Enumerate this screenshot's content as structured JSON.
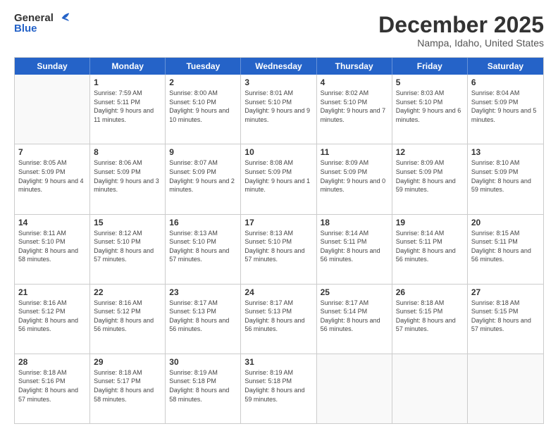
{
  "header": {
    "logo_general": "General",
    "logo_blue": "Blue",
    "title": "December 2025",
    "subtitle": "Nampa, Idaho, United States"
  },
  "days": [
    "Sunday",
    "Monday",
    "Tuesday",
    "Wednesday",
    "Thursday",
    "Friday",
    "Saturday"
  ],
  "weeks": [
    [
      {
        "day": "",
        "sunrise": "",
        "sunset": "",
        "daylight": ""
      },
      {
        "day": "1",
        "sunrise": "Sunrise: 7:59 AM",
        "sunset": "Sunset: 5:11 PM",
        "daylight": "Daylight: 9 hours and 11 minutes."
      },
      {
        "day": "2",
        "sunrise": "Sunrise: 8:00 AM",
        "sunset": "Sunset: 5:10 PM",
        "daylight": "Daylight: 9 hours and 10 minutes."
      },
      {
        "day": "3",
        "sunrise": "Sunrise: 8:01 AM",
        "sunset": "Sunset: 5:10 PM",
        "daylight": "Daylight: 9 hours and 9 minutes."
      },
      {
        "day": "4",
        "sunrise": "Sunrise: 8:02 AM",
        "sunset": "Sunset: 5:10 PM",
        "daylight": "Daylight: 9 hours and 7 minutes."
      },
      {
        "day": "5",
        "sunrise": "Sunrise: 8:03 AM",
        "sunset": "Sunset: 5:10 PM",
        "daylight": "Daylight: 9 hours and 6 minutes."
      },
      {
        "day": "6",
        "sunrise": "Sunrise: 8:04 AM",
        "sunset": "Sunset: 5:09 PM",
        "daylight": "Daylight: 9 hours and 5 minutes."
      }
    ],
    [
      {
        "day": "7",
        "sunrise": "Sunrise: 8:05 AM",
        "sunset": "Sunset: 5:09 PM",
        "daylight": "Daylight: 9 hours and 4 minutes."
      },
      {
        "day": "8",
        "sunrise": "Sunrise: 8:06 AM",
        "sunset": "Sunset: 5:09 PM",
        "daylight": "Daylight: 9 hours and 3 minutes."
      },
      {
        "day": "9",
        "sunrise": "Sunrise: 8:07 AM",
        "sunset": "Sunset: 5:09 PM",
        "daylight": "Daylight: 9 hours and 2 minutes."
      },
      {
        "day": "10",
        "sunrise": "Sunrise: 8:08 AM",
        "sunset": "Sunset: 5:09 PM",
        "daylight": "Daylight: 9 hours and 1 minute."
      },
      {
        "day": "11",
        "sunrise": "Sunrise: 8:09 AM",
        "sunset": "Sunset: 5:09 PM",
        "daylight": "Daylight: 9 hours and 0 minutes."
      },
      {
        "day": "12",
        "sunrise": "Sunrise: 8:09 AM",
        "sunset": "Sunset: 5:09 PM",
        "daylight": "Daylight: 8 hours and 59 minutes."
      },
      {
        "day": "13",
        "sunrise": "Sunrise: 8:10 AM",
        "sunset": "Sunset: 5:09 PM",
        "daylight": "Daylight: 8 hours and 59 minutes."
      }
    ],
    [
      {
        "day": "14",
        "sunrise": "Sunrise: 8:11 AM",
        "sunset": "Sunset: 5:10 PM",
        "daylight": "Daylight: 8 hours and 58 minutes."
      },
      {
        "day": "15",
        "sunrise": "Sunrise: 8:12 AM",
        "sunset": "Sunset: 5:10 PM",
        "daylight": "Daylight: 8 hours and 57 minutes."
      },
      {
        "day": "16",
        "sunrise": "Sunrise: 8:13 AM",
        "sunset": "Sunset: 5:10 PM",
        "daylight": "Daylight: 8 hours and 57 minutes."
      },
      {
        "day": "17",
        "sunrise": "Sunrise: 8:13 AM",
        "sunset": "Sunset: 5:10 PM",
        "daylight": "Daylight: 8 hours and 57 minutes."
      },
      {
        "day": "18",
        "sunrise": "Sunrise: 8:14 AM",
        "sunset": "Sunset: 5:11 PM",
        "daylight": "Daylight: 8 hours and 56 minutes."
      },
      {
        "day": "19",
        "sunrise": "Sunrise: 8:14 AM",
        "sunset": "Sunset: 5:11 PM",
        "daylight": "Daylight: 8 hours and 56 minutes."
      },
      {
        "day": "20",
        "sunrise": "Sunrise: 8:15 AM",
        "sunset": "Sunset: 5:11 PM",
        "daylight": "Daylight: 8 hours and 56 minutes."
      }
    ],
    [
      {
        "day": "21",
        "sunrise": "Sunrise: 8:16 AM",
        "sunset": "Sunset: 5:12 PM",
        "daylight": "Daylight: 8 hours and 56 minutes."
      },
      {
        "day": "22",
        "sunrise": "Sunrise: 8:16 AM",
        "sunset": "Sunset: 5:12 PM",
        "daylight": "Daylight: 8 hours and 56 minutes."
      },
      {
        "day": "23",
        "sunrise": "Sunrise: 8:17 AM",
        "sunset": "Sunset: 5:13 PM",
        "daylight": "Daylight: 8 hours and 56 minutes."
      },
      {
        "day": "24",
        "sunrise": "Sunrise: 8:17 AM",
        "sunset": "Sunset: 5:13 PM",
        "daylight": "Daylight: 8 hours and 56 minutes."
      },
      {
        "day": "25",
        "sunrise": "Sunrise: 8:17 AM",
        "sunset": "Sunset: 5:14 PM",
        "daylight": "Daylight: 8 hours and 56 minutes."
      },
      {
        "day": "26",
        "sunrise": "Sunrise: 8:18 AM",
        "sunset": "Sunset: 5:15 PM",
        "daylight": "Daylight: 8 hours and 57 minutes."
      },
      {
        "day": "27",
        "sunrise": "Sunrise: 8:18 AM",
        "sunset": "Sunset: 5:15 PM",
        "daylight": "Daylight: 8 hours and 57 minutes."
      }
    ],
    [
      {
        "day": "28",
        "sunrise": "Sunrise: 8:18 AM",
        "sunset": "Sunset: 5:16 PM",
        "daylight": "Daylight: 8 hours and 57 minutes."
      },
      {
        "day": "29",
        "sunrise": "Sunrise: 8:18 AM",
        "sunset": "Sunset: 5:17 PM",
        "daylight": "Daylight: 8 hours and 58 minutes."
      },
      {
        "day": "30",
        "sunrise": "Sunrise: 8:19 AM",
        "sunset": "Sunset: 5:18 PM",
        "daylight": "Daylight: 8 hours and 58 minutes."
      },
      {
        "day": "31",
        "sunrise": "Sunrise: 8:19 AM",
        "sunset": "Sunset: 5:18 PM",
        "daylight": "Daylight: 8 hours and 59 minutes."
      },
      {
        "day": "",
        "sunrise": "",
        "sunset": "",
        "daylight": ""
      },
      {
        "day": "",
        "sunrise": "",
        "sunset": "",
        "daylight": ""
      },
      {
        "day": "",
        "sunrise": "",
        "sunset": "",
        "daylight": ""
      }
    ]
  ]
}
